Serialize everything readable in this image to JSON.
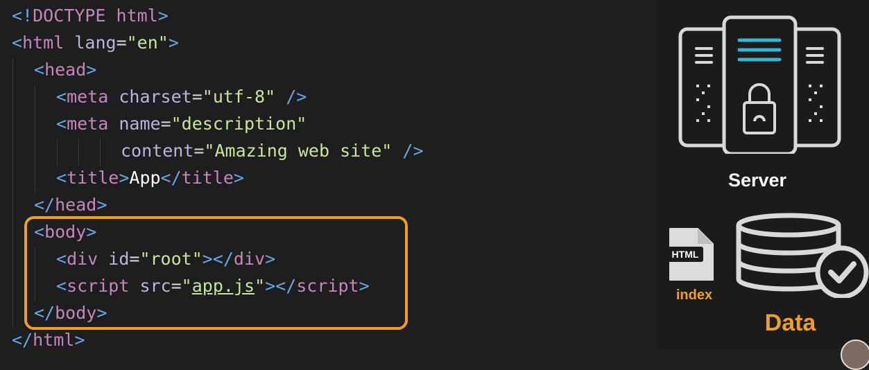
{
  "code": {
    "doctype": {
      "open": "<!",
      "keyword": "DOCTYPE",
      "name": " html",
      "close": ">"
    },
    "html_open": {
      "name": "html",
      "attr": "lang",
      "value": "\"en\""
    },
    "head_open": "head",
    "meta_charset": {
      "name": "meta",
      "attr": "charset",
      "value": "\"utf-8\""
    },
    "meta_description": {
      "name": "meta",
      "attr": "name",
      "value": "\"description\""
    },
    "meta_content": {
      "attr": "content",
      "value": "\"Amazing web site\""
    },
    "title": {
      "name": "title",
      "text": "App"
    },
    "head_close": "head",
    "body_open": "body",
    "div_root": {
      "name": "div",
      "attr": "id",
      "value": "\"root\""
    },
    "script": {
      "name": "script",
      "attr": "src",
      "value": "app.js"
    },
    "body_close": "body",
    "html_close": "html"
  },
  "colors": {
    "highlight": "#f0a020",
    "server_line": "#35b6d0",
    "label_accent": "#f0a020"
  },
  "sidebar": {
    "server_label": "Server",
    "file_badge": "HTML",
    "file_label": "index",
    "data_label": "Data"
  }
}
